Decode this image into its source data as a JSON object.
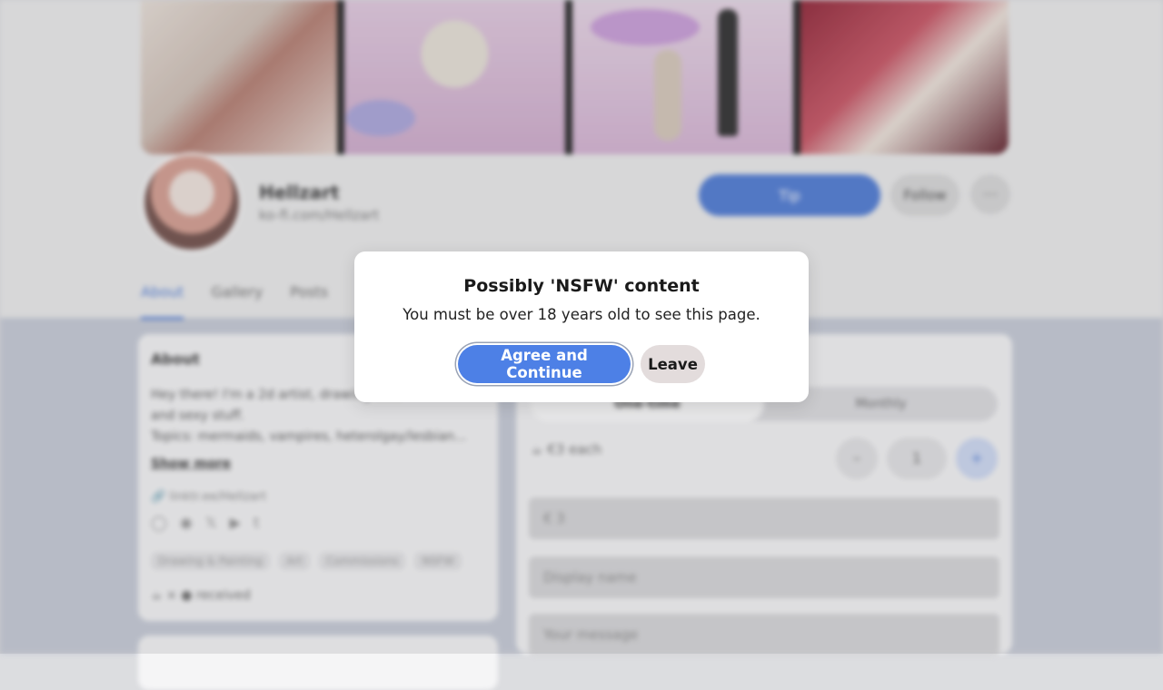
{
  "profile": {
    "name": "Hellzart",
    "handle": "ko-fi.com/Hellzart",
    "tip_label": "Tip",
    "follow_label": "Follow",
    "more_label": "⋯"
  },
  "tabs": [
    "About",
    "Gallery",
    "Posts"
  ],
  "about": {
    "title": "About",
    "text_line1": "Hey there! I'm a 2d artist, drawing cute",
    "text_line2": "and sexy stuff.",
    "text_line3": "Topics: mermaids, vampires, heterolgay/lesbian...",
    "show_more": "Show more",
    "link": "linktr.ee/Hellzart",
    "social_icons": [
      "patreon-icon",
      "twitch-icon",
      "x-icon",
      "youtube-icon",
      "tumblr-icon"
    ],
    "tags": [
      "Drawing & Painting",
      "Art",
      "Commissions",
      "NSFW"
    ],
    "supporters": "received"
  },
  "tip": {
    "one_time": "One-time",
    "monthly": "Monthly",
    "price": "€3 each",
    "minus": "–",
    "qty": "1",
    "plus": "+",
    "amount_placeholder": "€ 3",
    "name_placeholder": "Display name",
    "message_placeholder": "Your message"
  },
  "modal": {
    "title": "Possibly 'NSFW' content",
    "subtitle": "You must be over 18 years old to see this page.",
    "agree_label": "Agree and Continue",
    "leave_label": "Leave"
  },
  "colors": {
    "accent": "#4d80e6",
    "leave_bg": "#e3dcdc"
  }
}
